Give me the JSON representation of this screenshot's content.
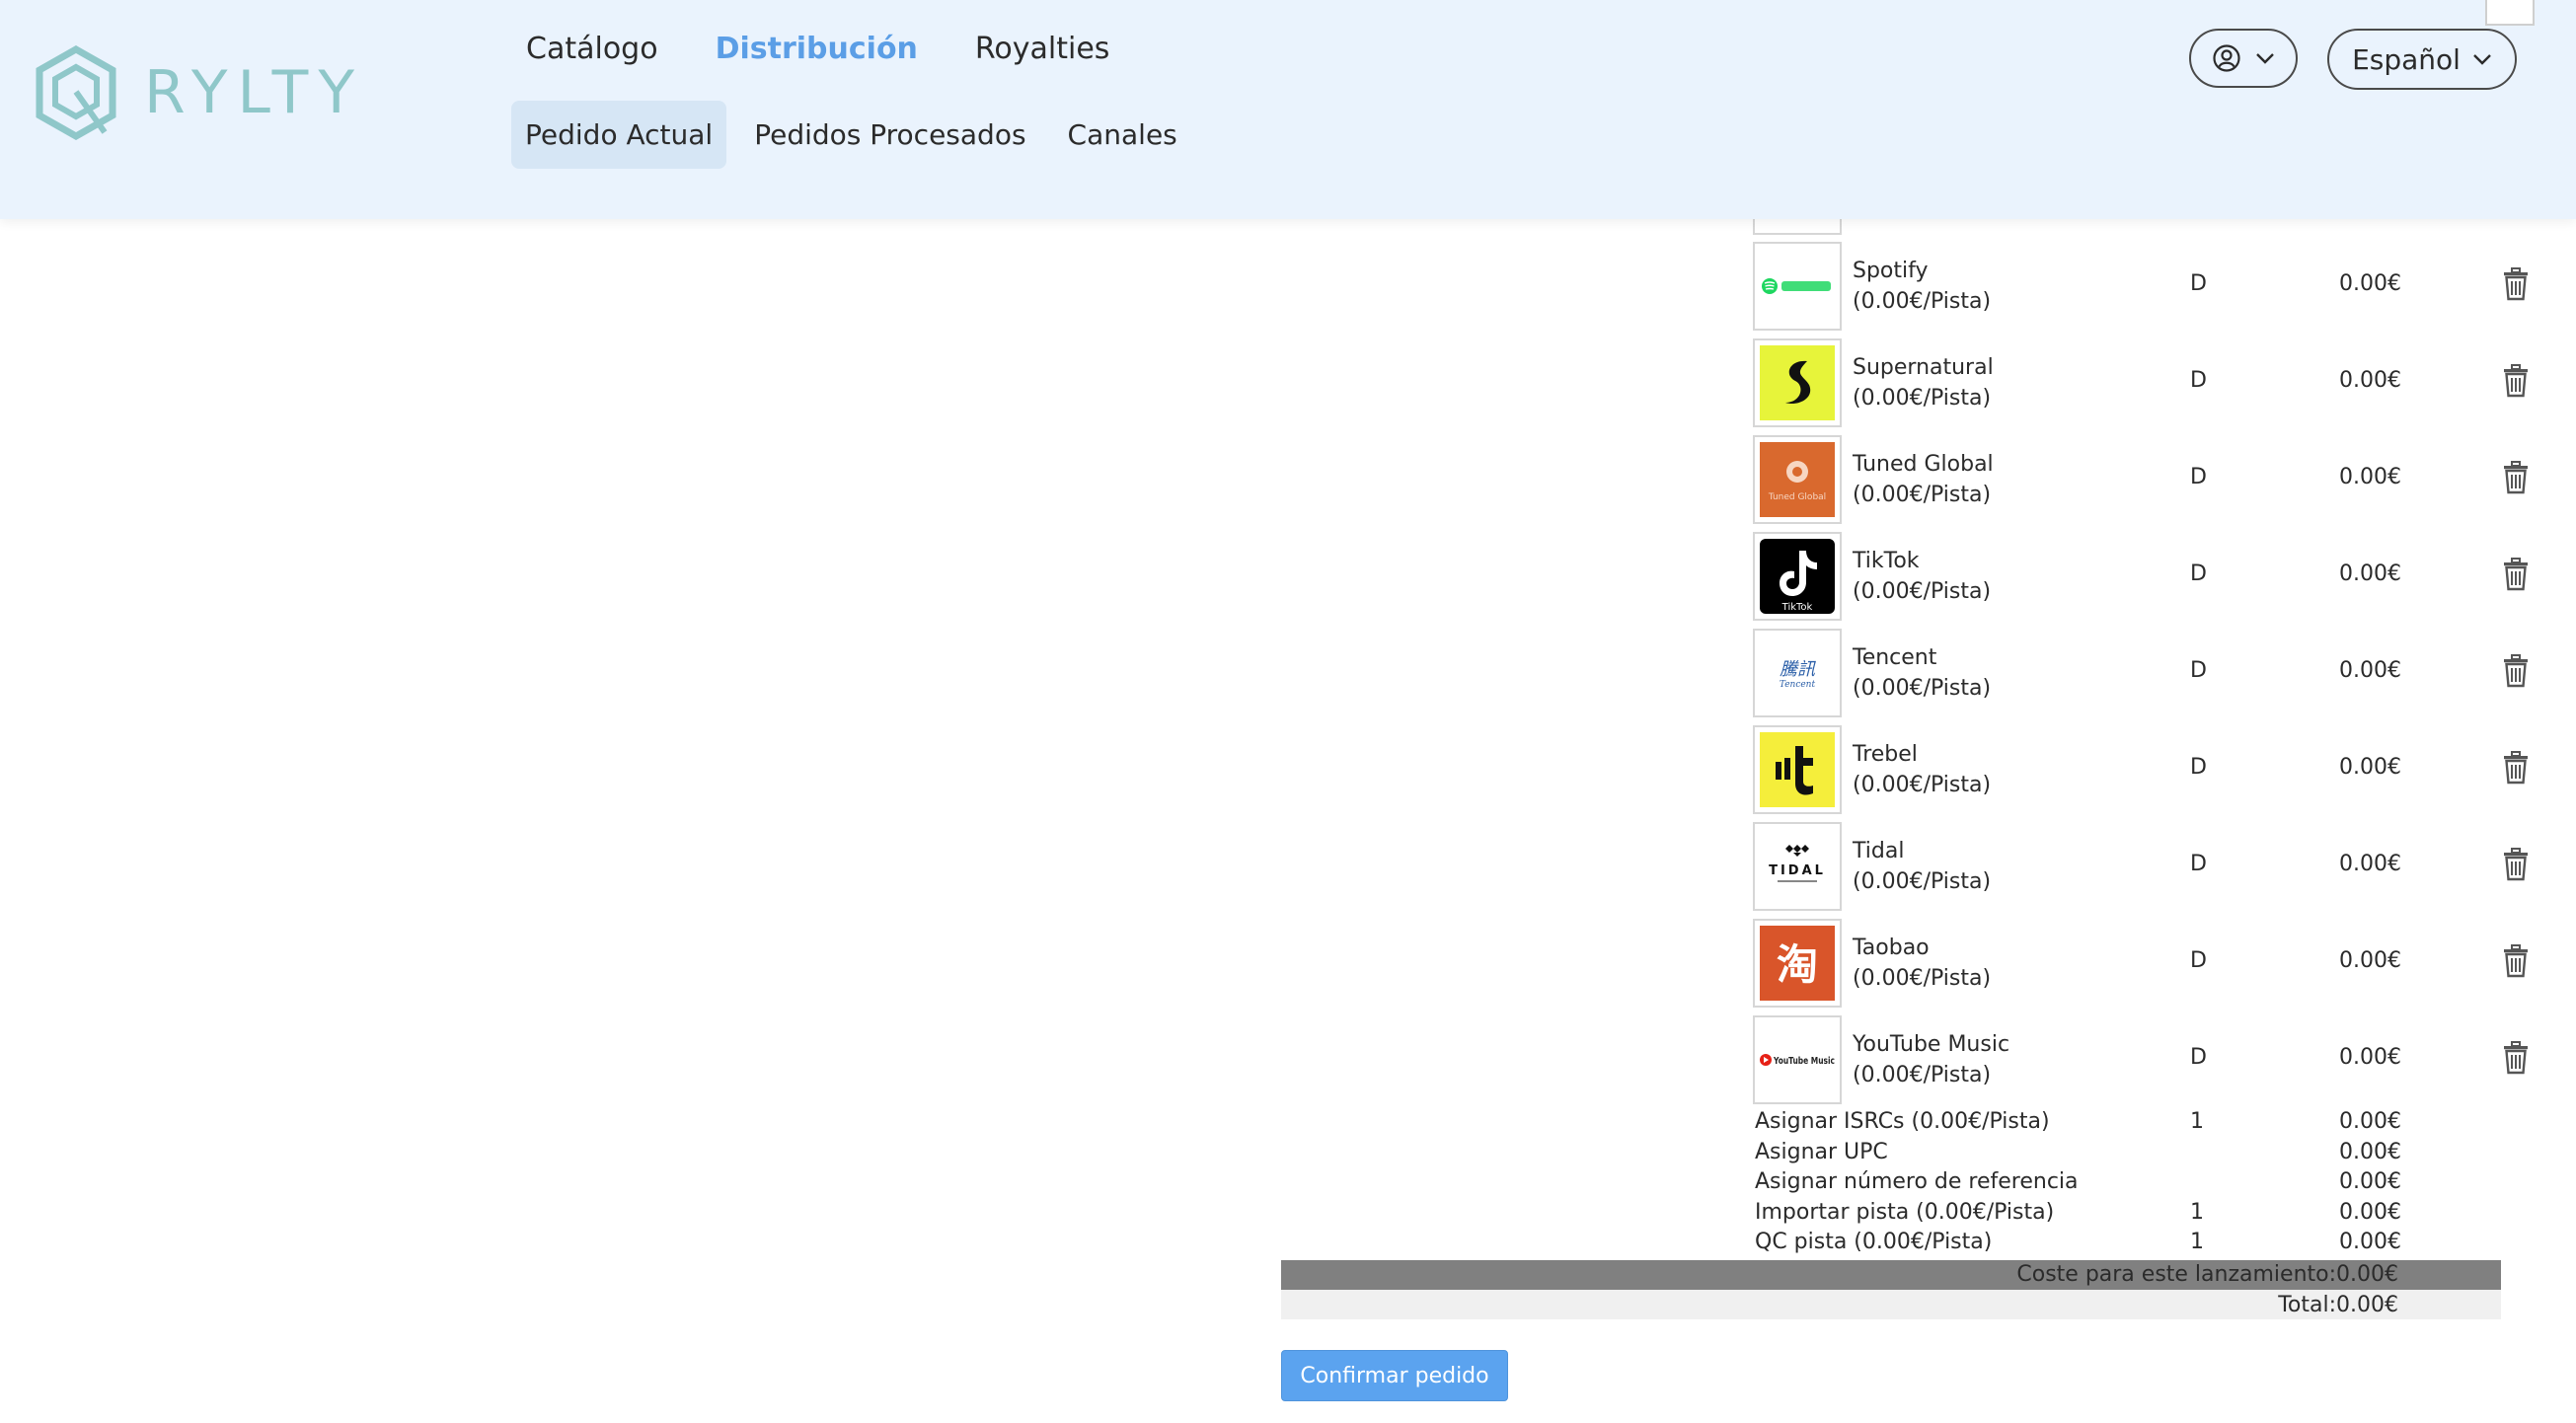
{
  "brand": {
    "name": "RYLTY"
  },
  "nav": {
    "top": [
      {
        "label": "Catálogo",
        "active": false
      },
      {
        "label": "Distribución",
        "active": true
      },
      {
        "label": "Royalties",
        "active": false
      }
    ],
    "sub": [
      {
        "label": "Pedido Actual",
        "active": true
      },
      {
        "label": "Pedidos Procesados",
        "active": false
      },
      {
        "label": "Canales",
        "active": false
      }
    ]
  },
  "user_menu": {
    "icon": "user-circle-icon"
  },
  "language": {
    "selected": "Español"
  },
  "services": [
    {
      "name": "Spotify",
      "rate": "(0.00€/Pista)",
      "qty": "D",
      "price": "0.00€",
      "logo": "spotify",
      "color": "#1ed760"
    },
    {
      "name": "Supernatural",
      "rate": "(0.00€/Pista)",
      "qty": "D",
      "price": "0.00€",
      "logo": "supernatural",
      "color": "#e7f43a"
    },
    {
      "name": "Tuned Global",
      "rate": "(0.00€/Pista)",
      "qty": "D",
      "price": "0.00€",
      "logo": "tuned-global",
      "color": "#d9692e",
      "logo_text": "Tuned Global"
    },
    {
      "name": "TikTok",
      "rate": "(0.00€/Pista)",
      "qty": "D",
      "price": "0.00€",
      "logo": "tiktok",
      "color": "#000000",
      "logo_text": "TikTok"
    },
    {
      "name": "Tencent",
      "rate": "(0.00€/Pista)",
      "qty": "D",
      "price": "0.00€",
      "logo": "tencent",
      "color": "#2b5fa8",
      "logo_text": "騰訊",
      "logo_subtext": "Tencent"
    },
    {
      "name": "Trebel",
      "rate": "(0.00€/Pista)",
      "qty": "D",
      "price": "0.00€",
      "logo": "trebel",
      "color": "#f5ee3b"
    },
    {
      "name": "Tidal",
      "rate": "(0.00€/Pista)",
      "qty": "D",
      "price": "0.00€",
      "logo": "tidal",
      "color": "#111111",
      "logo_text": "TIDAL"
    },
    {
      "name": "Taobao",
      "rate": "(0.00€/Pista)",
      "qty": "D",
      "price": "0.00€",
      "logo": "taobao",
      "color": "#d9552a",
      "logo_text": "淘"
    },
    {
      "name": "YouTube Music",
      "rate": "(0.00€/Pista)",
      "qty": "D",
      "price": "0.00€",
      "logo": "youtube-music",
      "color": "#e62117",
      "logo_text": "YouTube Music"
    }
  ],
  "extras": [
    {
      "label": "Asignar ISRCs (0.00€/Pista)",
      "qty": "1",
      "price": "0.00€"
    },
    {
      "label": "Asignar UPC",
      "qty": "",
      "price": "0.00€"
    },
    {
      "label": "Asignar número de referencia",
      "qty": "",
      "price": "0.00€"
    },
    {
      "label": "Importar pista (0.00€/Pista)",
      "qty": "1",
      "price": "0.00€"
    },
    {
      "label": "QC pista (0.00€/Pista)",
      "qty": "1",
      "price": "0.00€"
    }
  ],
  "summary": {
    "release_cost": "Coste para este lanzamiento:0.00€",
    "total": "Total:0.00€"
  },
  "actions": {
    "confirm_label": "Confirmar pedido"
  },
  "colors": {
    "header_bg": "#eaf3fd",
    "accent": "#5b9ee6",
    "button": "#5ba3ef"
  }
}
